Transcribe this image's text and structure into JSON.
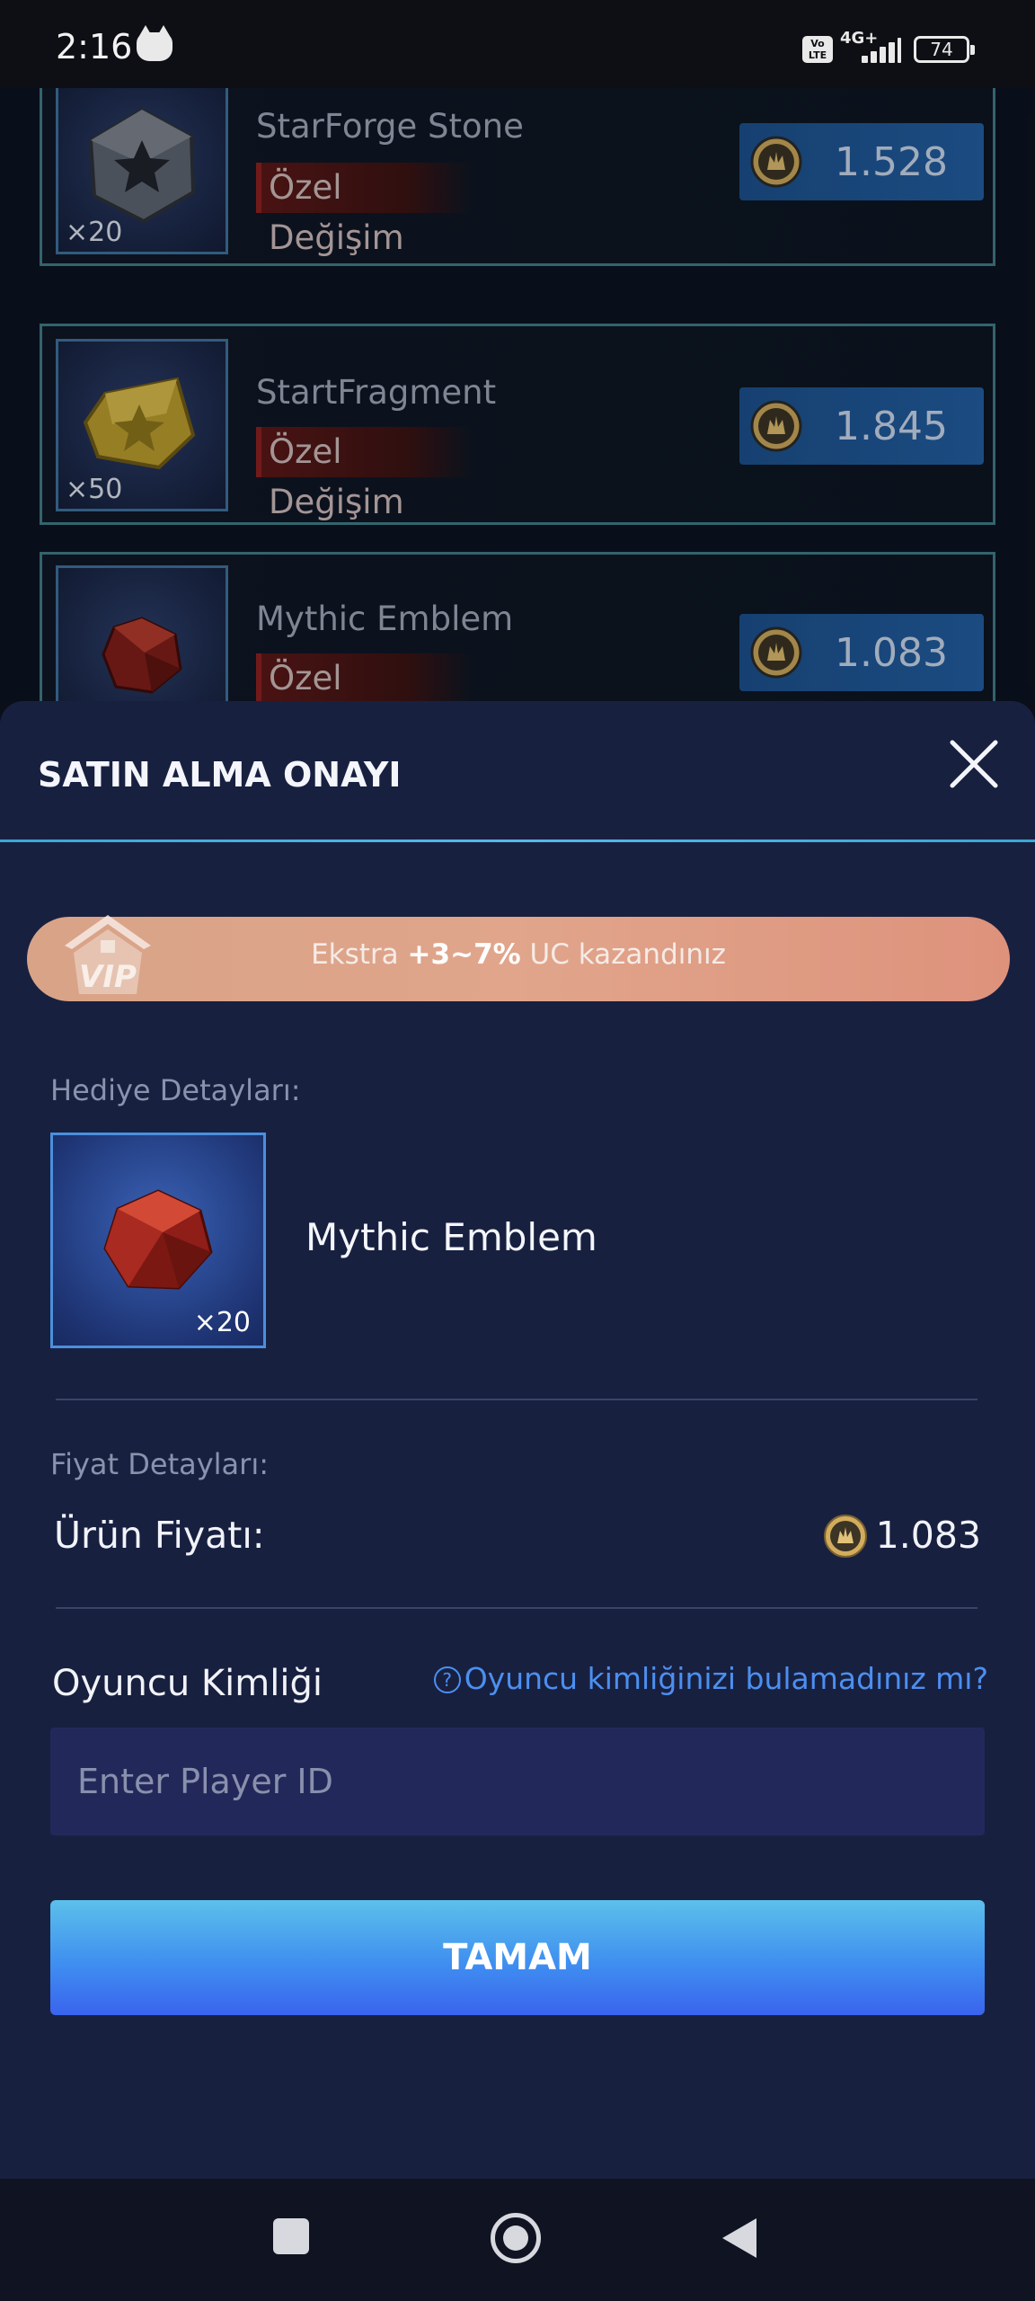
{
  "status_bar": {
    "time": "2:16",
    "volte_label": "Vo LTE",
    "network": "4G+",
    "battery": "74"
  },
  "store": {
    "items": [
      {
        "name": "StarForge Stone",
        "tag": "Özel Değişim",
        "qty": "×20",
        "price": "1.528",
        "icon": "star-stone-icon"
      },
      {
        "name": "StartFragment",
        "tag": "Özel Değişim",
        "qty": "×50",
        "price": "1.845",
        "icon": "star-fragment-icon"
      },
      {
        "name": "Mythic Emblem",
        "tag": "Özel Değişim",
        "qty": "",
        "price": "1.083",
        "icon": "mythic-emblem-icon"
      }
    ]
  },
  "dialog": {
    "title": "SATIN ALMA ONAYI",
    "vip": {
      "badge": "VIP",
      "text_prefix": "Ekstra ",
      "text_bold": "+3~7%",
      "text_suffix": " UC kazandınız"
    },
    "gift_section_label": "Hediye Detayları:",
    "gift": {
      "name": "Mythic Emblem",
      "qty": "×20",
      "icon": "mythic-emblem-icon"
    },
    "price_section_label": "Fiyat Detayları:",
    "price_label": "Ürün Fiyatı:",
    "price_value": "1.083",
    "player_id_label": "Oyuncu Kimliği",
    "help_icon": "?",
    "help_link": "Oyuncu kimliğinizi bulamadınız mı?",
    "player_id_placeholder": "Enter Player ID",
    "player_id_value": "",
    "confirm_button": "TAMAM"
  },
  "colors": {
    "sheet_bg": "#182040",
    "accent_blue": "#3f8ff0",
    "link_blue": "#4c8ff0",
    "vip_banner": "#d8a387",
    "card_border": "#3f7b86",
    "tag_red": "#5a1717"
  }
}
